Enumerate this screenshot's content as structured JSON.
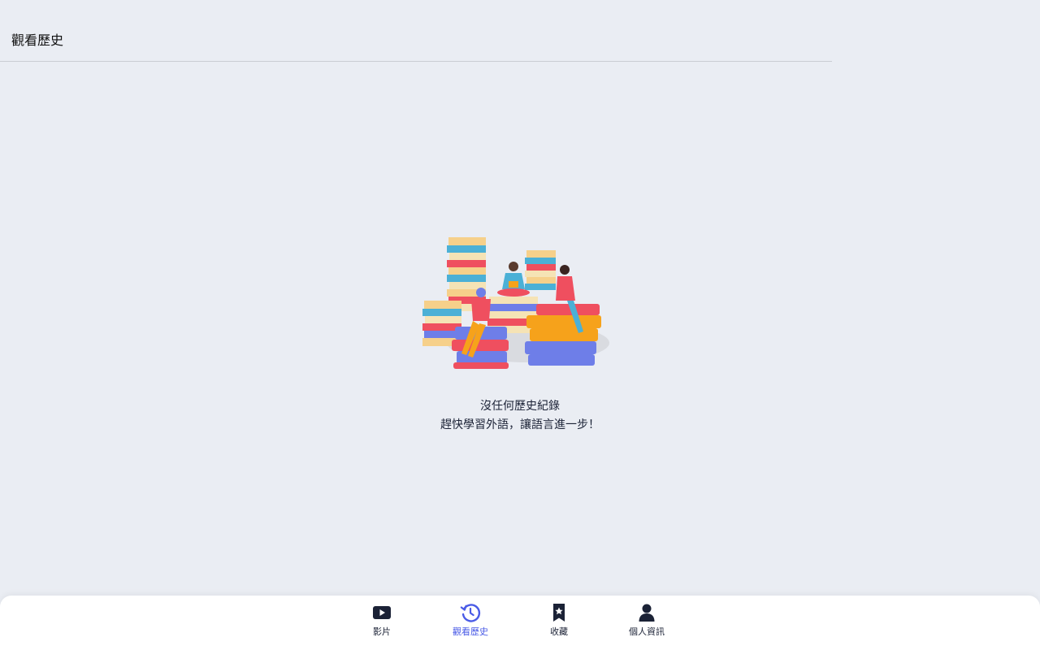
{
  "header": {
    "title": "觀看歷史"
  },
  "empty_state": {
    "illustration_icon": "reading-books-illustration",
    "line1": "沒任何歷史紀錄",
    "line2": "趕快學習外語，讓語言進一步！"
  },
  "tabbar": {
    "active_color": "#4a5be6",
    "tabs": [
      {
        "label": "影片",
        "icon": "play-video-icon"
      },
      {
        "label": "觀看歷史",
        "icon": "history-icon",
        "active": true
      },
      {
        "label": "收藏",
        "icon": "bookmark-star-icon"
      },
      {
        "label": "個人資訊",
        "icon": "user-icon"
      }
    ]
  }
}
